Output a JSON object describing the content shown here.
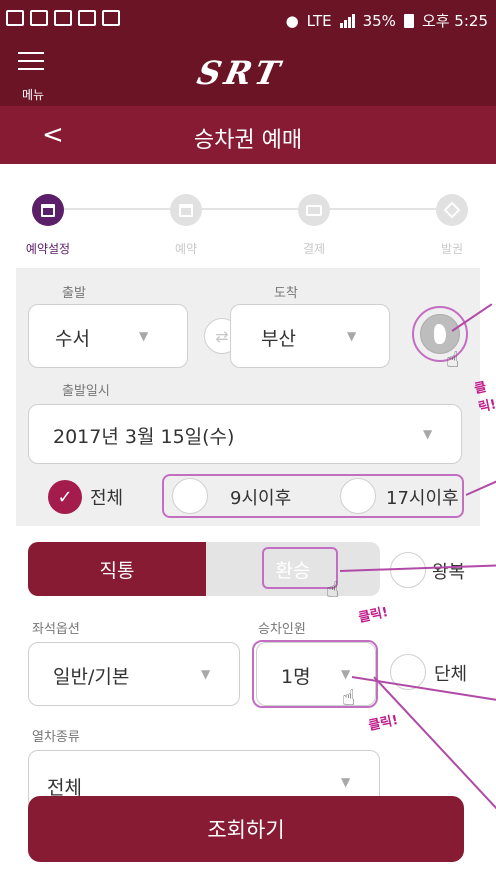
{
  "status_bar": {
    "signal_text": "LTE",
    "battery": "35%",
    "time": "오후 5:25"
  },
  "app_bar": {
    "menu_label": "메뉴",
    "logo_text": "SRT"
  },
  "title_bar": {
    "back_glyph": "<",
    "title": "승차권 예매"
  },
  "stepper": {
    "steps": [
      {
        "label": "예약설정",
        "icon": "calendar-icon",
        "active": true
      },
      {
        "label": "예약",
        "icon": "calendar-check-icon",
        "active": false
      },
      {
        "label": "결제",
        "icon": "card-icon",
        "active": false
      },
      {
        "label": "발권",
        "icon": "ticket-icon",
        "active": false
      }
    ]
  },
  "form": {
    "departure_label": "출발",
    "departure_value": "수서",
    "arrival_label": "도착",
    "arrival_value": "부산",
    "date_label": "출발일시",
    "date_value": "2017년 3월 15일(수)",
    "time_options": [
      "전체",
      "9시이후",
      "17시이후"
    ],
    "trip_type": {
      "direct": "직통",
      "transfer": "환승",
      "round_trip": "왕복"
    },
    "seat_label": "좌석옵션",
    "seat_value": "일반/기본",
    "passenger_label": "승차인원",
    "passenger_value": "1명",
    "group_label": "단체",
    "train_type_label": "열차종류",
    "train_type_value": "전체"
  },
  "annotations": {
    "click_text": "클릭!"
  },
  "search_button": "조회하기",
  "colors": {
    "primary": "#861b33",
    "primary_dark": "#6b1426",
    "accent_purple": "#5b1e68",
    "check_red": "#a31c4b",
    "highlight": "#c26ec2"
  }
}
